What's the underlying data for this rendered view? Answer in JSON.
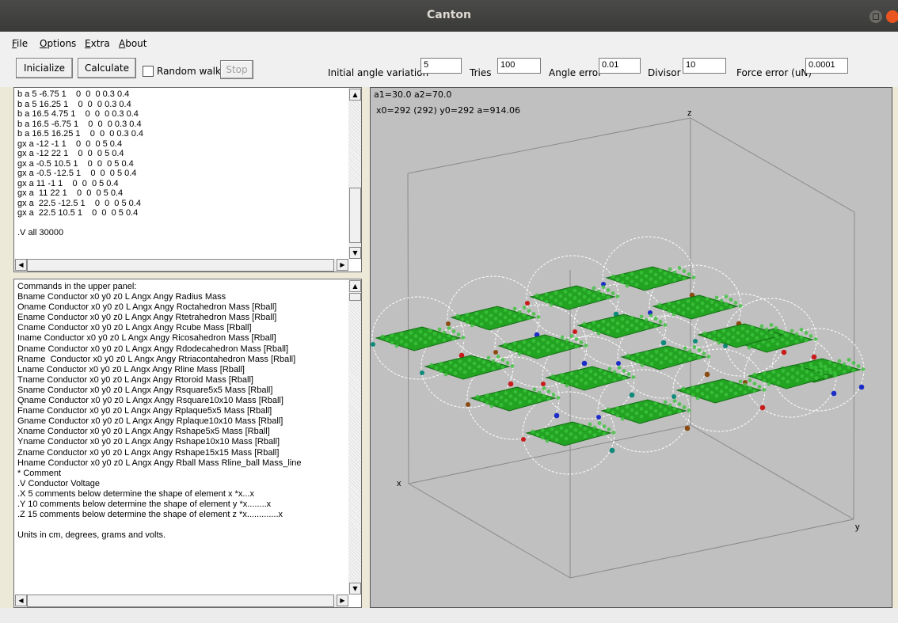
{
  "window": {
    "title": "Canton"
  },
  "menu": [
    {
      "label": "File",
      "key": "F",
      "rest": "ile"
    },
    {
      "label": "Options",
      "key": "O",
      "rest": "ptions"
    },
    {
      "label": "Extra",
      "key": "E",
      "rest": "xtra"
    },
    {
      "label": "About",
      "key": "A",
      "rest": "bout"
    }
  ],
  "toolbar": {
    "initialize_label": "Inicialize",
    "calculate_label": "Calculate",
    "random_walk_label": "Random walk",
    "random_walk_checked": false,
    "stop_label": "Stop",
    "initial_angle_variation_label": "Initial angle variation",
    "initial_angle_variation_value": "5",
    "tries_label": "Tries",
    "tries_value": "100",
    "angle_error_label": "Angle error",
    "angle_error_value": "0.01",
    "divisor_label": "Divisor",
    "divisor_value": "10",
    "force_error_label": "Force error (uN)",
    "force_error_value": "0.0001"
  },
  "editor_lines": [
    "b a 5 -6.75 1    0  0  0 0.3 0.4",
    "b a 5 16.25 1    0  0  0 0.3 0.4",
    "b a 16.5 4.75 1    0  0  0 0.3 0.4",
    "b a 16.5 -6.75 1    0  0  0 0.3 0.4",
    "b a 16.5 16.25 1    0  0  0 0.3 0.4",
    "gx a -12 -1 1    0  0  0 5 0.4",
    "gx a -12 22 1    0  0  0 5 0.4",
    "gx a -0.5 10.5 1    0  0  0 5 0.4",
    "gx a -0.5 -12.5 1    0  0  0 5 0.4",
    "gx a 11 -1 1    0  0  0 5 0.4",
    "gx a  11 22 1    0  0  0 5 0.4",
    "gx a  22.5 -12.5 1    0  0  0 5 0.4",
    "gx a  22.5 10.5 1    0  0  0 5 0.4",
    "",
    ".V all 30000"
  ],
  "help_lines": [
    "Commands in the upper panel:",
    "Bname Conductor x0 y0 z0 L Angx Angy Radius Mass",
    "Oname Conductor x0 y0 z0 L Angx Angy Roctahedron Mass [Rball]",
    "Ename Conductor x0 y0 z0 L Angx Angy Rtetrahedron Mass [Rball]",
    "Cname Conductor x0 y0 z0 L Angx Angy Rcube Mass [Rball]",
    "Iname Conductor x0 y0 z0 L Angx Angy Ricosahedron Mass [Rball]",
    "Dname Conductor x0 y0 z0 L Angx Angy Rdodecahedron Mass [Rball]",
    "Rname  Conductor x0 y0 z0 L Angx Angy Rtriacontahedron Mass [Rball]",
    "Lname Conductor x0 y0 z0 L Angx Angy Rline Mass [Rball]",
    "Tname Conductor x0 y0 z0 L Angx Angy Rtoroid Mass [Rball]",
    "Sname Conductor x0 y0 z0 L Angx Angy Rsquare5x5 Mass [Rball]",
    "Qname Conductor x0 y0 z0 L Angx Angy Rsquare10x10 Mass [Rball]",
    "Fname Conductor x0 y0 z0 L Angx Angy Rplaque5x5 Mass [Rball]",
    "Gname Conductor x0 y0 z0 L Angx Angy Rplaque10x10 Mass [Rball]",
    "Xname Conductor x0 y0 z0 L Angx Angy Rshape5x5 Mass [Rball]",
    "Yname Conductor x0 y0 z0 L Angx Angy Rshape10x10 Mass [Rball]",
    "Zname Conductor x0 y0 z0 L Angx Angy Rshape15x15 Mass [Rball]",
    "Hname Conductor x0 y0 z0 L Angx Angy Rball Mass Rline_ball Mass_line",
    "* Comment",
    ".V Conductor Voltage",
    ".X 5 comments below determine the shape of element x *x...x",
    ".Y 10 comments below determine the shape of element y *x........x",
    ".Z 15 comments below determine the shape of element z *x.............x",
    "",
    "Units in cm, degrees, grams and volts."
  ],
  "view": {
    "angles_text": "a1=30.0 a2=70.0",
    "origin_text": "x0=292 (292) y0=292 a=914.06",
    "axis_x": "x",
    "axis_y": "y",
    "axis_z": "z",
    "background_color": "#c0c0c0",
    "plate_color": "#22a322",
    "ball_colors": [
      "#c81c1c",
      "#1c2cc8",
      "#0e8a7a",
      "#8a4a10"
    ]
  }
}
